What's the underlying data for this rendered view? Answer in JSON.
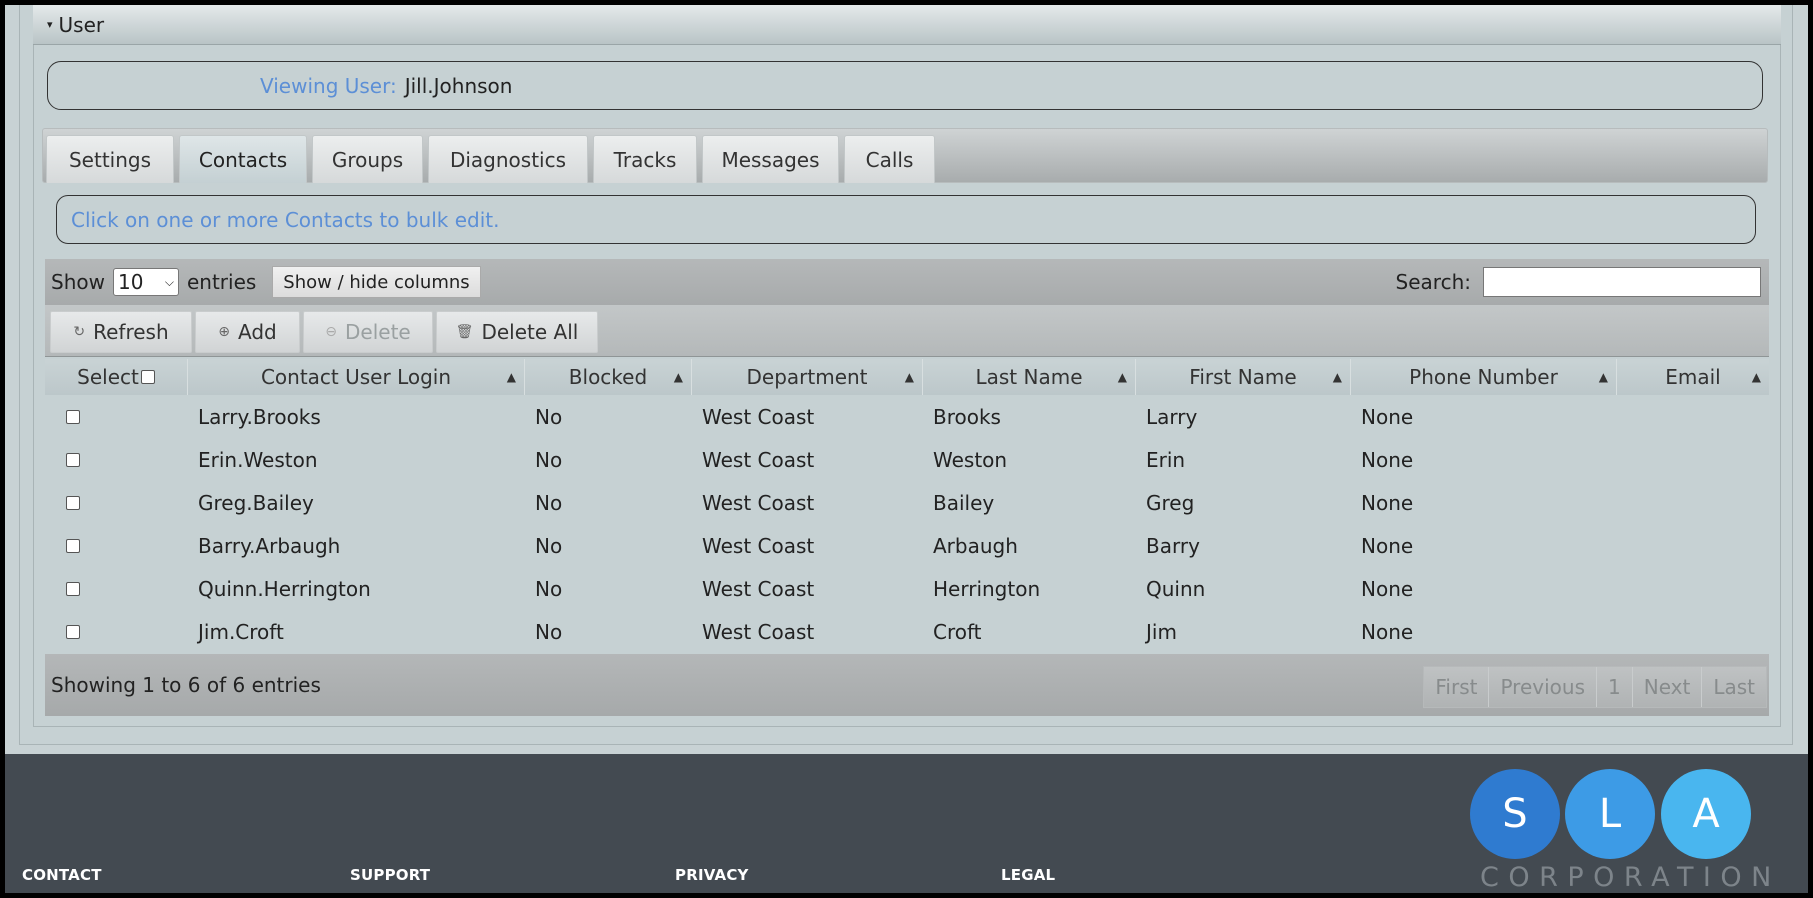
{
  "section": {
    "title": "User",
    "caret": "▾"
  },
  "viewing": {
    "label": "Viewing User:",
    "user": "Jill.Johnson"
  },
  "tabs": [
    {
      "label": "Settings"
    },
    {
      "label": "Contacts",
      "active": true
    },
    {
      "label": "Groups"
    },
    {
      "label": "Diagnostics"
    },
    {
      "label": "Tracks"
    },
    {
      "label": "Messages"
    },
    {
      "label": "Calls"
    }
  ],
  "hint": "Click on one or more Contacts to bulk edit.",
  "length": {
    "show": "Show",
    "value": "10",
    "entries": "entries"
  },
  "colvis_label": "Show / hide columns",
  "search": {
    "label": "Search:",
    "value": ""
  },
  "actions": {
    "refresh": "Refresh",
    "add": "Add",
    "delete": "Delete",
    "delete_all": "Delete All"
  },
  "columns": [
    "Select",
    "Contact User Login",
    "Blocked",
    "Department",
    "Last Name",
    "First Name",
    "Phone Number",
    "Email"
  ],
  "rows": [
    {
      "login": "Larry.Brooks",
      "blocked": "No",
      "department": "West Coast",
      "last": "Brooks",
      "first": "Larry",
      "phone": "None",
      "email": ""
    },
    {
      "login": "Erin.Weston",
      "blocked": "No",
      "department": "West Coast",
      "last": "Weston",
      "first": "Erin",
      "phone": "None",
      "email": ""
    },
    {
      "login": "Greg.Bailey",
      "blocked": "No",
      "department": "West Coast",
      "last": "Bailey",
      "first": "Greg",
      "phone": "None",
      "email": ""
    },
    {
      "login": "Barry.Arbaugh",
      "blocked": "No",
      "department": "West Coast",
      "last": "Arbaugh",
      "first": "Barry",
      "phone": "None",
      "email": ""
    },
    {
      "login": "Quinn.Herrington",
      "blocked": "No",
      "department": "West Coast",
      "last": "Herrington",
      "first": "Quinn",
      "phone": "None",
      "email": ""
    },
    {
      "login": "Jim.Croft",
      "blocked": "No",
      "department": "West Coast",
      "last": "Croft",
      "first": "Jim",
      "phone": "None",
      "email": ""
    }
  ],
  "info": "Showing 1 to 6 of 6 entries",
  "pager": {
    "first": "First",
    "previous": "Previous",
    "page": "1",
    "next": "Next",
    "last": "Last"
  },
  "footer": {
    "links": [
      "CONTACT",
      "SUPPORT",
      "PRIVACY",
      "LEGAL"
    ],
    "logo": {
      "letters": [
        "S",
        "L",
        "A"
      ],
      "word": "CORPORATION",
      "colors": [
        "#2f7bd0",
        "#3d9be6",
        "#49b6ef"
      ]
    }
  }
}
